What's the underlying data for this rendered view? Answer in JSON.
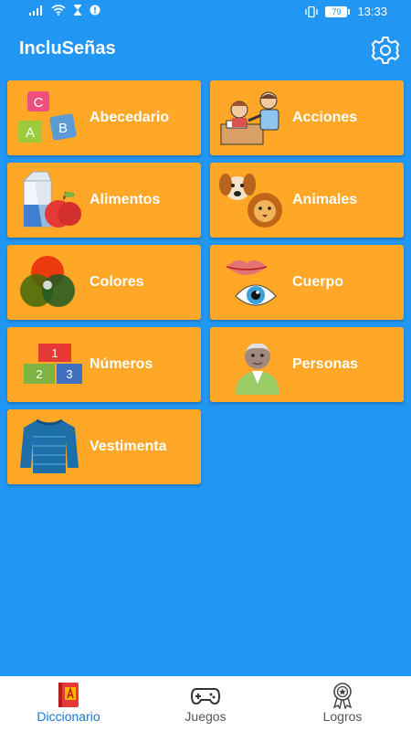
{
  "status_bar": {
    "battery": "79",
    "time": "13:33"
  },
  "app": {
    "title": "IncluSeñas"
  },
  "categories": [
    {
      "label": "Abecedario"
    },
    {
      "label": "Acciones"
    },
    {
      "label": "Alimentos"
    },
    {
      "label": "Animales"
    },
    {
      "label": "Colores"
    },
    {
      "label": "Cuerpo"
    },
    {
      "label": "Números"
    },
    {
      "label": "Personas"
    },
    {
      "label": "Vestimenta"
    }
  ],
  "tile_icons": {
    "abc_block_letters": [
      "C",
      "A",
      "B"
    ],
    "number_block_digits": [
      "1",
      "2",
      "3"
    ]
  },
  "bottom_nav": [
    {
      "label": "Diccionario",
      "active": true
    },
    {
      "label": "Juegos",
      "active": false
    },
    {
      "label": "Logros",
      "active": false
    }
  ],
  "colors": {
    "background": "#2196f3",
    "tile": "#ffa726",
    "nav_active": "#1976d2"
  }
}
